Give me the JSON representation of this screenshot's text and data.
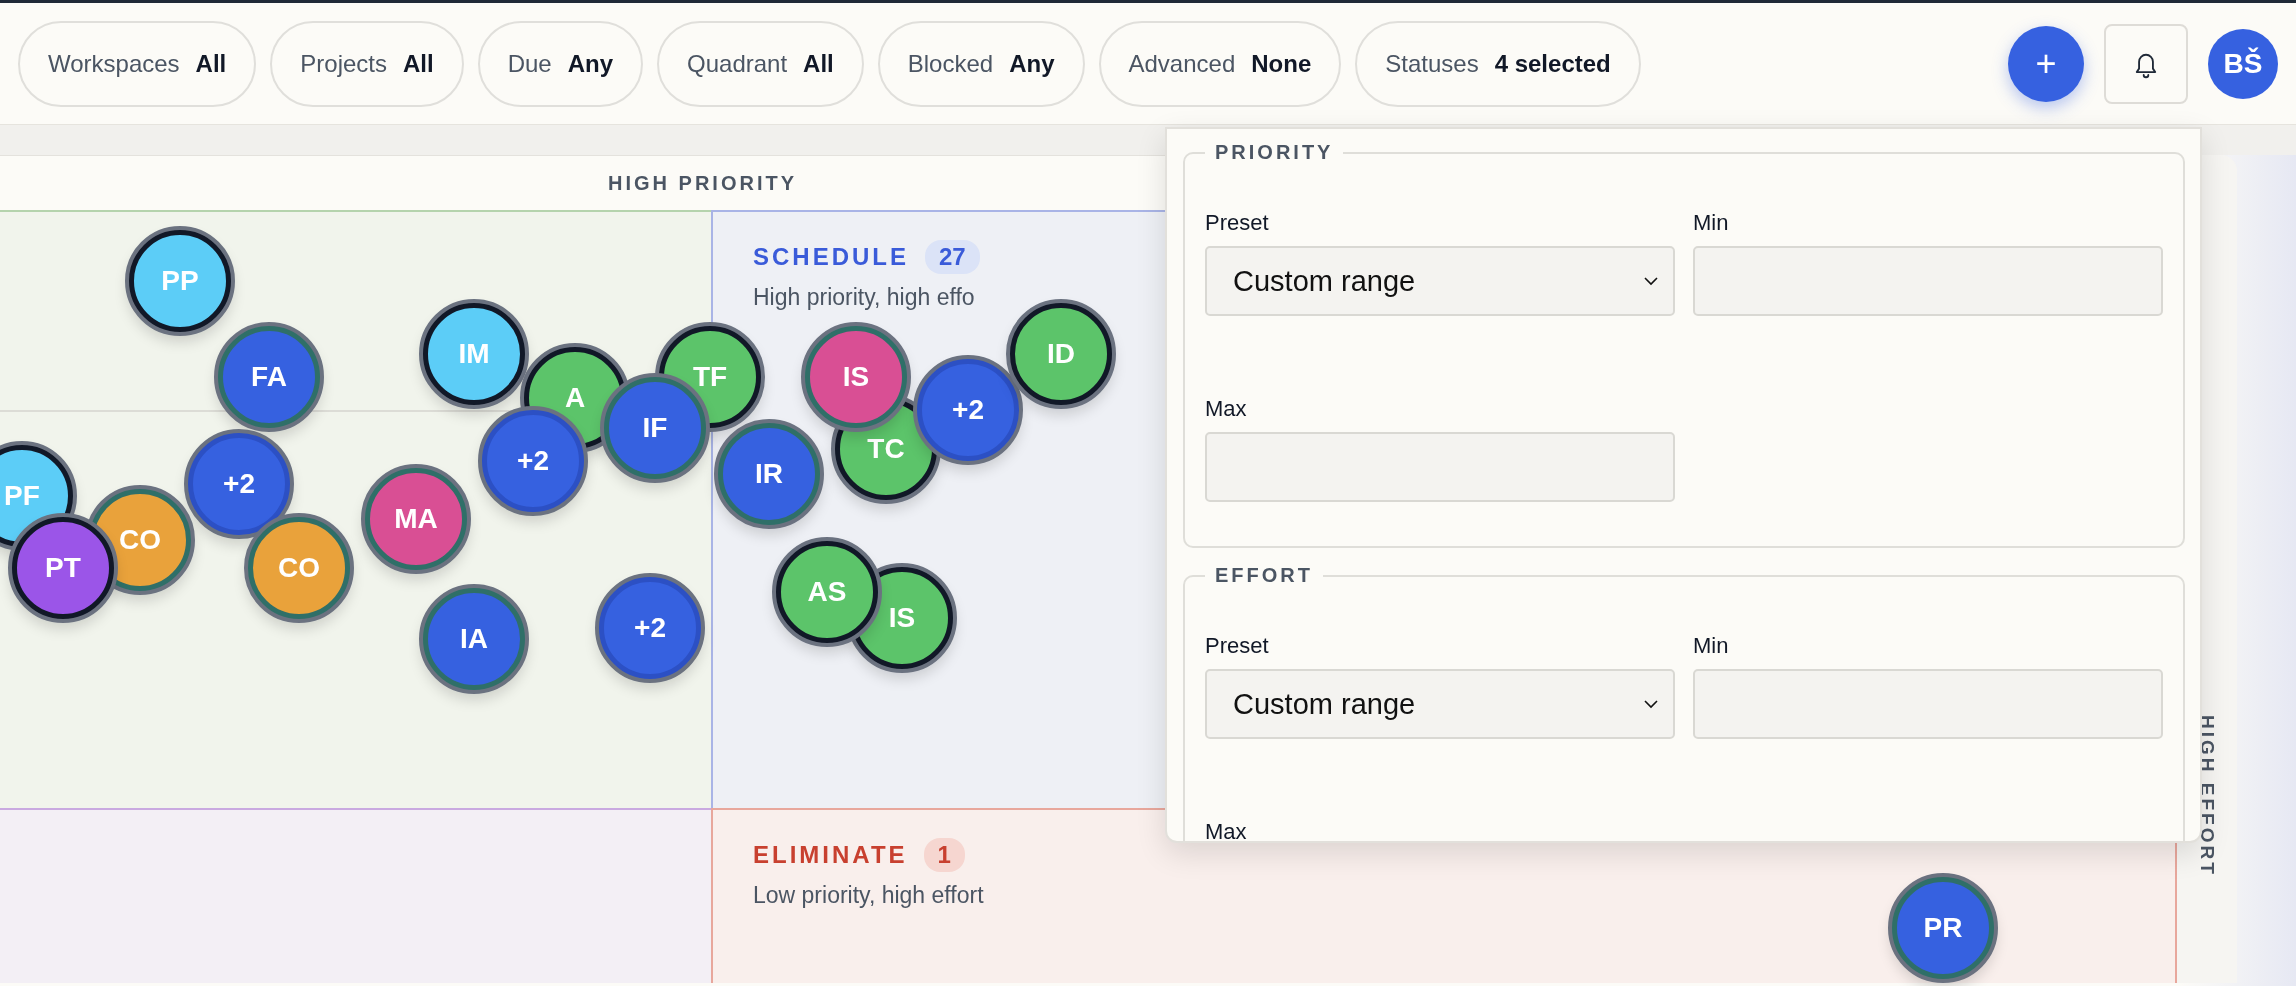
{
  "filters": [
    {
      "label": "Workspaces",
      "value": "All"
    },
    {
      "label": "Projects",
      "value": "All"
    },
    {
      "label": "Due",
      "value": "Any"
    },
    {
      "label": "Quadrant",
      "value": "All"
    },
    {
      "label": "Blocked",
      "value": "Any"
    },
    {
      "label": "Advanced",
      "value": "None"
    },
    {
      "label": "Statuses",
      "value": "4 selected"
    }
  ],
  "add_button": {
    "label": "+"
  },
  "avatar": {
    "initials": "BŠ"
  },
  "matrix": {
    "top_axis": "HIGH PRIORITY",
    "right_axis": "HIGH EFFORT",
    "quadrants": [
      {
        "kind": "schedule",
        "title": "SCHEDULE",
        "count": "27",
        "description": "High priority, high effo"
      },
      {
        "kind": "eliminate",
        "title": "ELIMINATE",
        "count": "1",
        "description": "Low priority, high effort"
      }
    ],
    "bubbles": [
      {
        "label": "PP",
        "color": "#5ccdf7",
        "kind": "dark"
      },
      {
        "label": "FA",
        "color": "#3661e0",
        "kind": "teal"
      },
      {
        "label": "IM",
        "color": "#5ccdf7",
        "kind": "dark"
      },
      {
        "label": "A",
        "color": "#5cc46a",
        "kind": "dark"
      },
      {
        "label": "TF",
        "color": "#5cc46a",
        "kind": "dark"
      },
      {
        "label": "IF",
        "color": "#3661e0",
        "kind": "teal"
      },
      {
        "label": "+2",
        "color": "#3661e0",
        "kind": "cluster"
      },
      {
        "label": "+2",
        "color": "#3661e0",
        "kind": "cluster"
      },
      {
        "label": "MA",
        "color": "#d94f94",
        "kind": "teal"
      },
      {
        "label": "PF",
        "color": "#5ccdf7",
        "kind": "dark"
      },
      {
        "label": "CO",
        "color": "#e9a23b",
        "kind": "teal"
      },
      {
        "label": "PT",
        "color": "#9b55e8",
        "kind": "dark"
      },
      {
        "label": "CO",
        "color": "#e9a23b",
        "kind": "teal"
      },
      {
        "label": "IA",
        "color": "#3661e0",
        "kind": "teal"
      },
      {
        "label": "+2",
        "color": "#3661e0",
        "kind": "cluster"
      },
      {
        "label": "TC",
        "color": "#5cc46a",
        "kind": "dark"
      },
      {
        "label": "IS",
        "color": "#d94f94",
        "kind": "teal"
      },
      {
        "label": "+2",
        "color": "#3661e0",
        "kind": "cluster"
      },
      {
        "label": "IR",
        "color": "#3661e0",
        "kind": "teal"
      },
      {
        "label": "ID",
        "color": "#5cc46a",
        "kind": "dark"
      },
      {
        "label": "IS",
        "color": "#5cc46a",
        "kind": "dark"
      },
      {
        "label": "AS",
        "color": "#5cc46a",
        "kind": "dark"
      },
      {
        "label": "PR",
        "color": "#3661e0",
        "kind": "teal"
      }
    ]
  },
  "popover": {
    "sections": [
      {
        "legend": "PRIORITY",
        "preset_label": "Preset",
        "preset_value": "Custom range",
        "min_label": "Min",
        "max_label": "Max"
      },
      {
        "legend": "EFFORT",
        "preset_label": "Preset",
        "preset_value": "Custom range",
        "min_label": "Min",
        "max_label": "Max"
      }
    ]
  }
}
